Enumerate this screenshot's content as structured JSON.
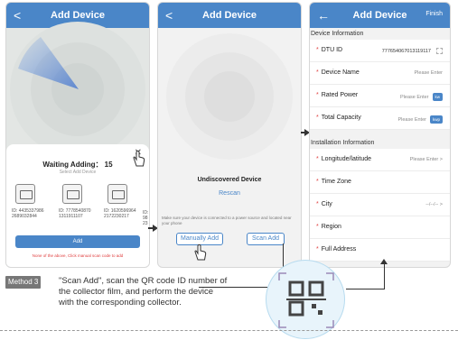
{
  "screen1": {
    "nav": {
      "back": "<",
      "title": "Add Device"
    },
    "sheet": {
      "waiting": "Waiting Adding： 15",
      "subtitle": "Select Add Device",
      "close": "✕",
      "devices": [
        {
          "label": "ID:",
          "id": "4435337986 2689032844"
        },
        {
          "label": "ID:",
          "id": "7778540870 1311911107"
        },
        {
          "label": "ID:",
          "id": "1620596964 2172230217"
        },
        {
          "label": "ID:",
          "id": "98 23"
        }
      ],
      "add_button": "Add",
      "warning": "None of the above, Click manual scan code to add"
    }
  },
  "screen2": {
    "nav": {
      "back": "<",
      "title": "Add Device"
    },
    "undiscovered": "Undiscovered Device",
    "rescan": "Rescan",
    "tip": "Make sure your device is connected to a power source and located near your phone",
    "manual_button": "Manually Add",
    "scan_button": "Scan Add"
  },
  "screen3": {
    "nav": {
      "back": "←",
      "title": "Add Device",
      "finish": "Finish"
    },
    "section1": "Device Information",
    "dtu_label": "DTU ID",
    "dtu_value": "777654067013119117",
    "device_name_label": "Device Name",
    "device_name_placeholder": "Please Enter",
    "rated_power_label": "Rated Power",
    "rated_power_placeholder": "Please Enter",
    "rated_power_unit": "kw",
    "total_capacity_label": "Total Capacity",
    "total_capacity_placeholder": "Please Enter",
    "total_capacity_unit": "kwp",
    "section2": "Installation Information",
    "longlat_label": "Longitude/latitude",
    "longlat_placeholder": "Please Enter",
    "timezone_label": "Time Zone",
    "city_label": "City",
    "city_value": "--/--/--",
    "region_label": "Region",
    "address_label": "Full Address",
    "chevron": ">"
  },
  "method": {
    "badge": "Method 3",
    "text": "\"Scan Add\", scan the QR code ID number of the collector film, and perform the device with the corresponding collector."
  },
  "colors": {
    "brand": "#4a86c8",
    "required": "#e04040"
  }
}
